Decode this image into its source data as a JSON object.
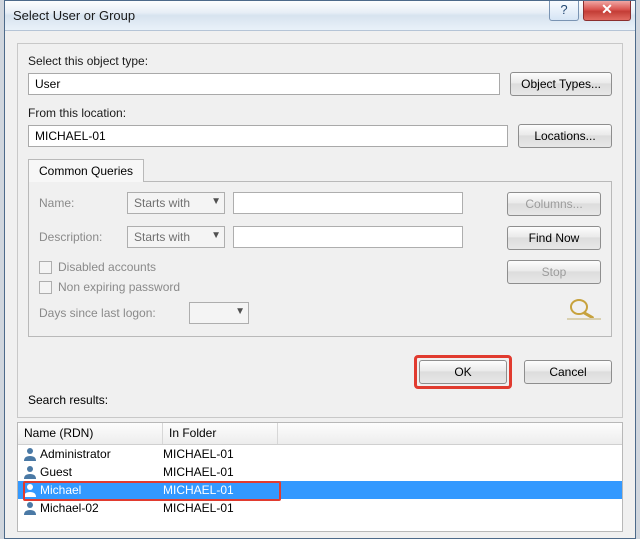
{
  "window": {
    "title": "Select User or Group"
  },
  "labels": {
    "object_type": "Select this object type:",
    "location": "From this location:",
    "tab": "Common Queries",
    "name": "Name:",
    "description": "Description:",
    "disabled": "Disabled accounts",
    "nonexpiring": "Non expiring password",
    "days": "Days since last logon:",
    "results": "Search results:"
  },
  "values": {
    "object_type": "User",
    "location": "MICHAEL-01",
    "name_mode": "Starts with",
    "desc_mode": "Starts with"
  },
  "buttons": {
    "object_types": "Object Types...",
    "locations": "Locations...",
    "columns": "Columns...",
    "find": "Find Now",
    "stop": "Stop",
    "ok": "OK",
    "cancel": "Cancel"
  },
  "columns": {
    "name": "Name (RDN)",
    "folder": "In Folder"
  },
  "results": [
    {
      "name": "Administrator",
      "folder": "MICHAEL-01",
      "selected": false
    },
    {
      "name": "Guest",
      "folder": "MICHAEL-01",
      "selected": false
    },
    {
      "name": "Michael",
      "folder": "MICHAEL-01",
      "selected": true
    },
    {
      "name": "Michael-02",
      "folder": "MICHAEL-01",
      "selected": false
    }
  ]
}
